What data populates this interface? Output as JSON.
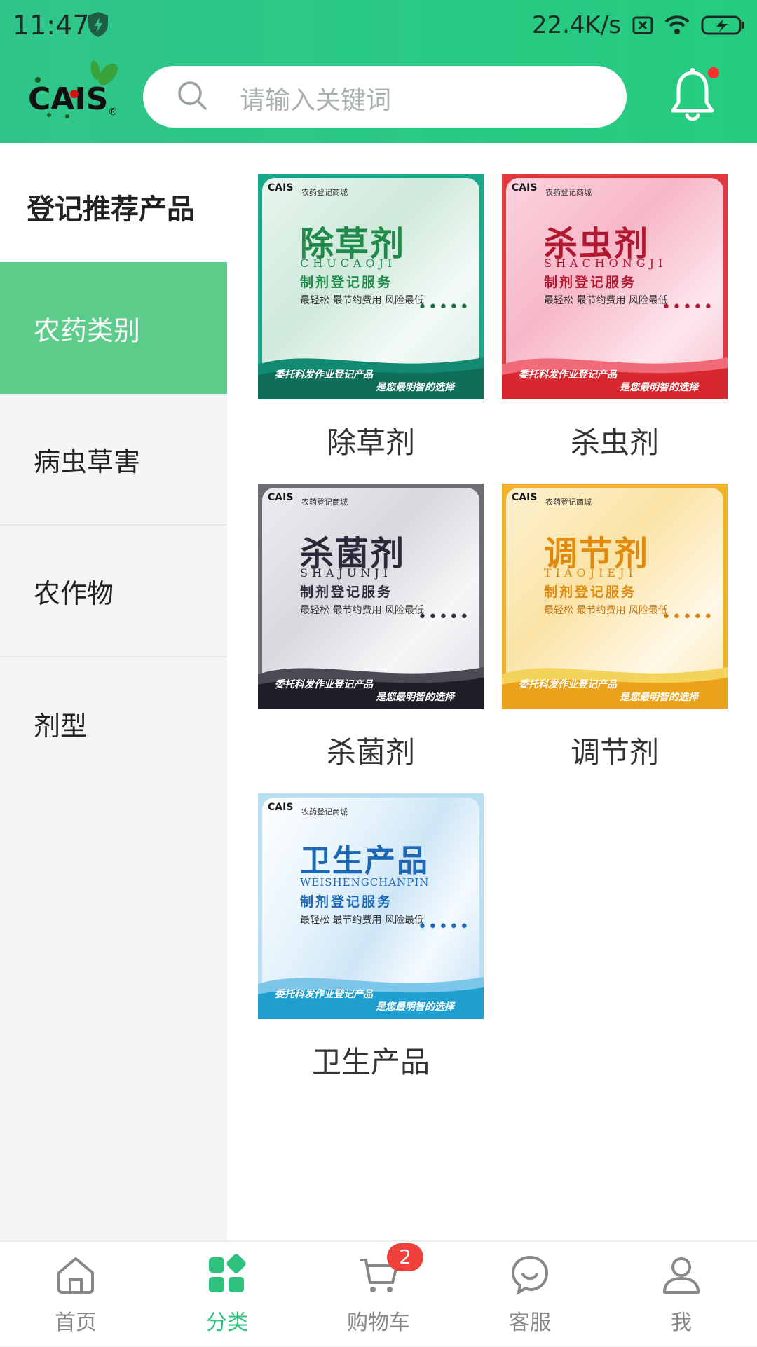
{
  "status_bar": {
    "time": "11:47",
    "net_speed": "22.4K/s",
    "icons": [
      "shield-icon",
      "no-sim-icon",
      "wifi-icon",
      "battery-charging-icon"
    ]
  },
  "header": {
    "logo_text": "CAIS",
    "search_placeholder": "请输入关键词",
    "accent": "#2fc58a"
  },
  "sidebar": {
    "title": "登记推荐产品",
    "items": [
      {
        "label": "农药类别",
        "active": true
      },
      {
        "label": "病虫草害",
        "active": false
      },
      {
        "label": "农作物",
        "active": false
      },
      {
        "label": "剂型",
        "active": false
      }
    ]
  },
  "products": [
    {
      "label": "除草剂",
      "img_title": "除草剂",
      "img_pinyin": "CHUCAOJI",
      "color": "#1f8a4a"
    },
    {
      "label": "杀虫剂",
      "img_title": "杀虫剂",
      "img_pinyin": "SHACHONGJI",
      "color": "#b0182f"
    },
    {
      "label": "杀菌剂",
      "img_title": "杀菌剂",
      "img_pinyin": "SHAJUNJI",
      "color": "#2a2a3a"
    },
    {
      "label": "调节剂",
      "img_title": "调节剂",
      "img_pinyin": "TIAOJIEJI",
      "color": "#e08a10"
    },
    {
      "label": "卫生产品",
      "img_title": "卫生产品",
      "img_pinyin": "WEISHENGCHANPIN",
      "color": "#1d68b4"
    }
  ],
  "card_common": {
    "shop": "农药登记商城",
    "service": "制剂登记服务",
    "slogan": "最轻松 最节约费用 风险最低",
    "footer1": "委托科发作业登记产品",
    "footer2": "是您最明智的选择",
    "logo": "CAIS"
  },
  "tabbar": {
    "items": [
      {
        "label": "首页",
        "icon": "home-icon"
      },
      {
        "label": "分类",
        "icon": "category-icon"
      },
      {
        "label": "购物车",
        "icon": "cart-icon"
      },
      {
        "label": "客服",
        "icon": "customer-service-icon"
      },
      {
        "label": "我",
        "icon": "user-icon"
      }
    ],
    "cart_badge": "2",
    "active_color": "#2ec27e"
  }
}
